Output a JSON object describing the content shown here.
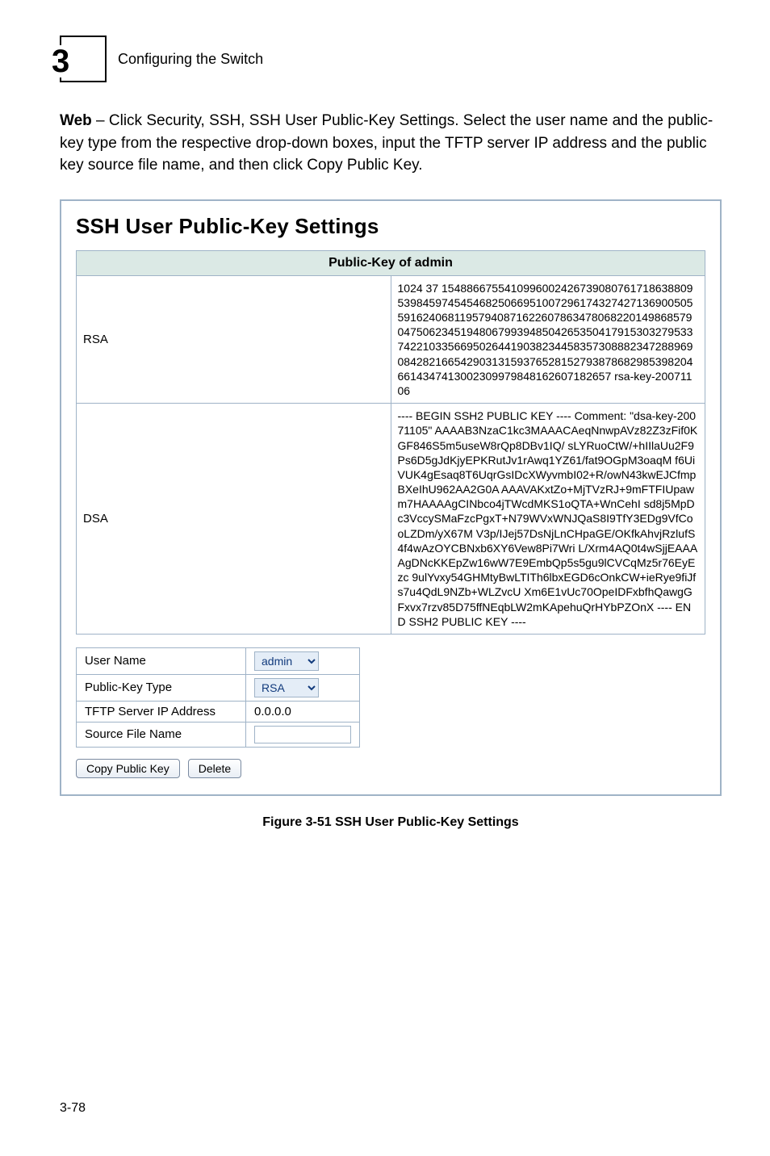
{
  "header": {
    "chapter_number": "3",
    "chapter_title": "Configuring the Switch"
  },
  "lead_html": "<b>Web</b> – Click Security, SSH, SSH User Public-Key Settings. Select the user name and the public-key type from the respective drop-down boxes, input the TFTP server IP address and the public key source file name, and then click Copy Public Key.",
  "panel": {
    "title": "SSH User Public-Key Settings",
    "pk_header": "Public-Key of admin",
    "rows": [
      {
        "label": "RSA",
        "text": "1024 37 154886675541099600242673908076171863880953984597454546825066951007296174327427136900505591624068119579408716226078634780682201498685790475062345194806799394850426535041791530327953374221033566950264419038234458357308882347288969084282166542903131593765281527938786829853982046614347413002309979848162607182657 rsa-key-20071106"
      },
      {
        "label": "DSA",
        "text": "---- BEGIN SSH2 PUBLIC KEY ---- Comment: \"dsa-key-20071105\" AAAAB3NzaC1kc3MAAACAeqNnwpAVz82Z3zFif0KGF846S5m5useW8rQp8DBv1IQ/ sLYRuoCtW/+hIIlaUu2F9Ps6D5gJdKjyEPKRutJv1rAwq1YZ61/fat9OGpM3oaqM f6UiVUK4gEsaq8T6UqrGsIDcXWyvmbI02+R/owN43kwEJCfmpBXeIhU962AA2G0A AAAVAKxtZo+MjTVzRJ+9mFTFIUpawm7HAAAAgCINbco4jTWcdMKS1oQTA+WnCehI sd8j5MpDc3VccySMaFzcPgxT+N79WVxWNJQaS8I9TfY3EDg9VfCooLZDm/yX67M V3p/IJej57DsNjLnCHpaGE/OKfkAhvjRzlufS4f4wAzOYCBNxb6XY6Vew8Pi7Wri L/Xrm4AQ0t4wSjjEAAAAgDNcKKEpZw16wW7E9EmbQp5s5gu9lCVCqMz5r76EyEzc 9ulYvxy54GHMtyBwLTITh6lbxEGD6cOnkCW+ieRye9fiJfs7u4QdL9NZb+WLZvcU Xm6E1vUc70OpeIDFxbfhQawgGFxvx7rzv85D75ffNEqbLW2mKApehuQrHYbPZOnX ---- END SSH2 PUBLIC KEY ----"
      }
    ],
    "form": {
      "user_name_label": "User Name",
      "user_name_value": "admin",
      "pk_type_label": "Public-Key Type",
      "pk_type_value": "RSA",
      "tftp_label": "TFTP Server IP Address",
      "tftp_value": "0.0.0.0",
      "src_label": "Source File Name",
      "src_value": ""
    },
    "buttons": {
      "copy": "Copy Public Key",
      "delete": "Delete"
    }
  },
  "caption": "Figure 3-51  SSH User Public-Key Settings",
  "page_number": "3-78"
}
